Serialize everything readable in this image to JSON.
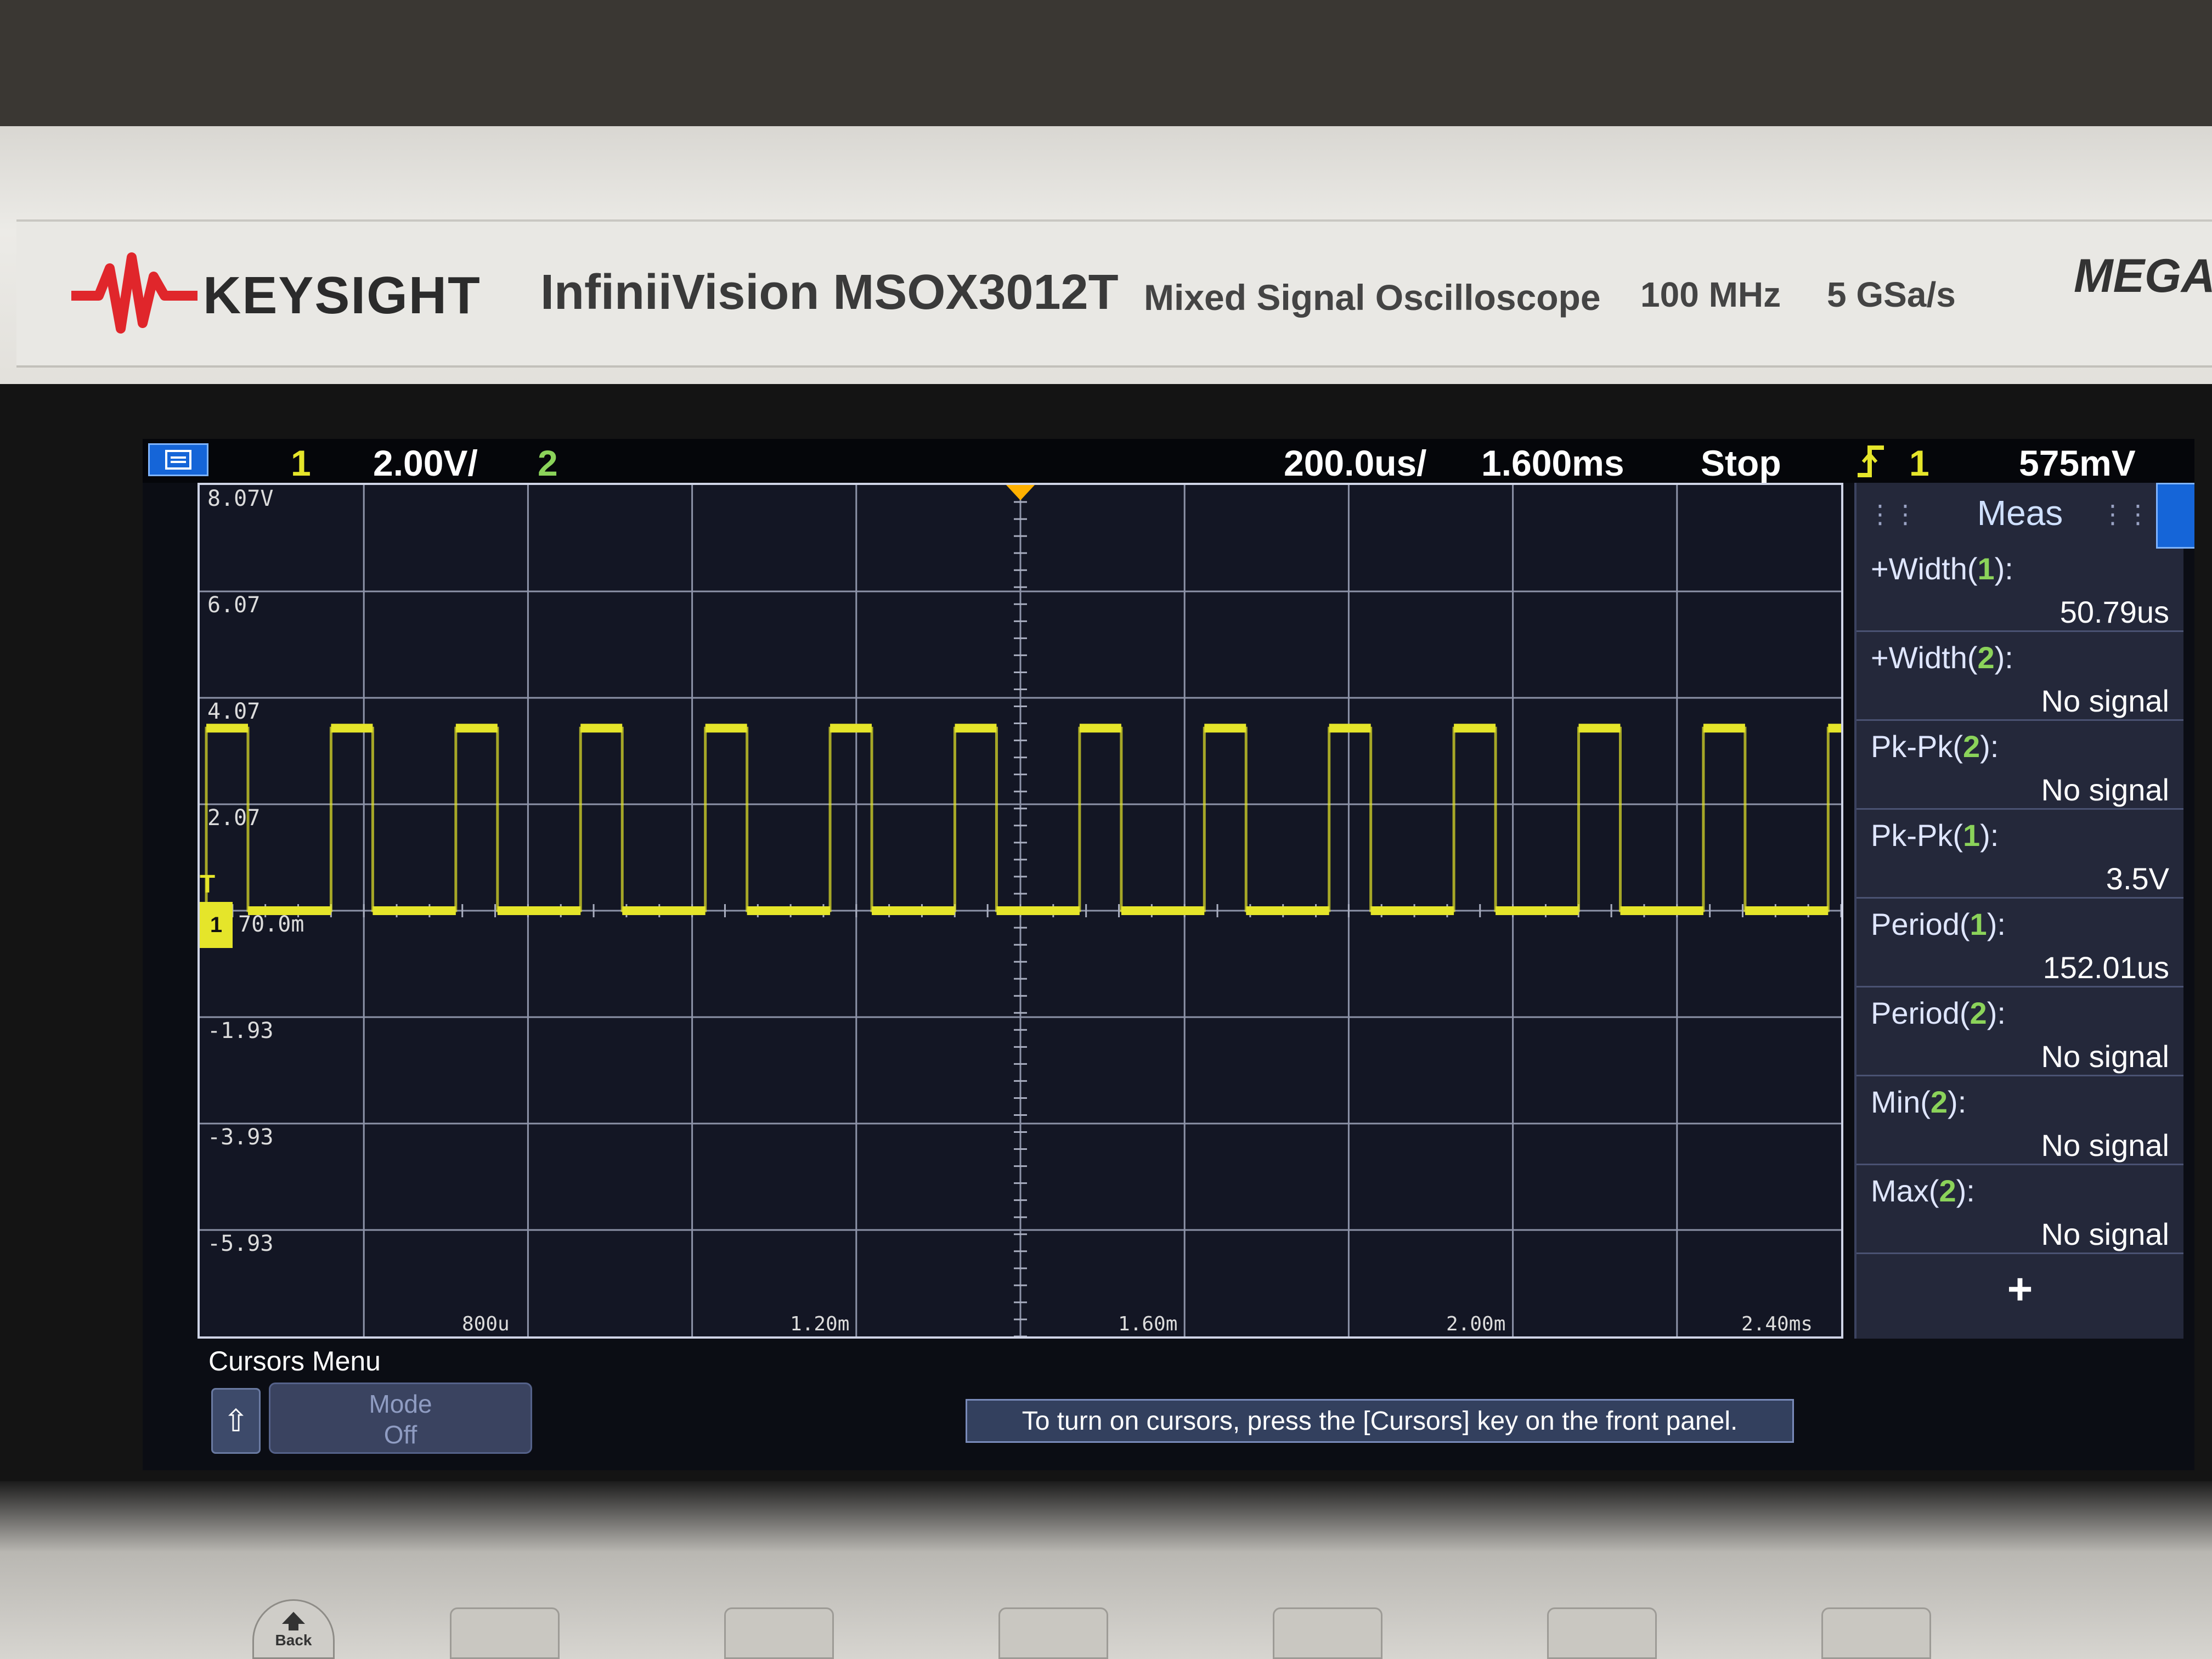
{
  "brand": {
    "logo_text": "KEYSIGHT",
    "model": "InfiniiVision MSOX3012T",
    "description": "Mixed Signal Oscilloscope",
    "bandwidth": "100 MHz",
    "sample_rate": "5 GSa/s",
    "mega": "MEGA"
  },
  "status": {
    "ch1": "1",
    "ch1_scale": "2.00V/",
    "ch2": "2",
    "timebase": "200.0us/",
    "delay": "1.600ms",
    "run_state": "Stop",
    "trigger_icon": "trigger-edge-icon",
    "trigger_source": "1",
    "trigger_level": "575mV"
  },
  "graticule": {
    "voltage_labels": [
      "8.07V",
      "6.07",
      "4.07",
      "2.07",
      "70.0m",
      "-1.93",
      "-3.93",
      "-5.93"
    ],
    "time_labels": [
      "800u",
      "1.20m",
      "1.60m",
      "2.00m",
      "2.40ms"
    ],
    "ground_marker": "1",
    "trigger_marker": "T"
  },
  "waveform": {
    "channel": "1",
    "color": "#e5e52a",
    "high_v": 3.5,
    "low_v": 0.07,
    "period_us": 152.01,
    "pos_width_us": 50.79
  },
  "meas": {
    "title": "Meas",
    "items": [
      {
        "name": "+Width(",
        "ch": "1",
        "suffix": "):",
        "value": "50.79us"
      },
      {
        "name": "+Width(",
        "ch": "2",
        "suffix": "):",
        "value": "No signal"
      },
      {
        "name": "Pk-Pk(",
        "ch": "2",
        "suffix": "):",
        "value": "No signal"
      },
      {
        "name": "Pk-Pk(",
        "ch": "1",
        "suffix": "):",
        "value": "3.5V"
      },
      {
        "name": "Period(",
        "ch": "1",
        "suffix": "):",
        "value": "152.01us"
      },
      {
        "name": "Period(",
        "ch": "2",
        "suffix": "):",
        "value": "No signal"
      },
      {
        "name": "Min(",
        "ch": "2",
        "suffix": "):",
        "value": "No signal"
      },
      {
        "name": "Max(",
        "ch": "2",
        "suffix": "):",
        "value": "No signal"
      }
    ],
    "add_label": "+"
  },
  "cursors": {
    "menu_title": "Cursors Menu",
    "back_icon": "up-arrow-icon",
    "mode_label": "Mode",
    "mode_value": "Off",
    "message": "To turn on cursors, press the [Cursors] key on the front panel."
  },
  "front_panel": {
    "back_label": "Back"
  },
  "colors": {
    "ch1": "#e5e52a",
    "ch2": "#8bd35a",
    "accent": "#1565d8"
  }
}
